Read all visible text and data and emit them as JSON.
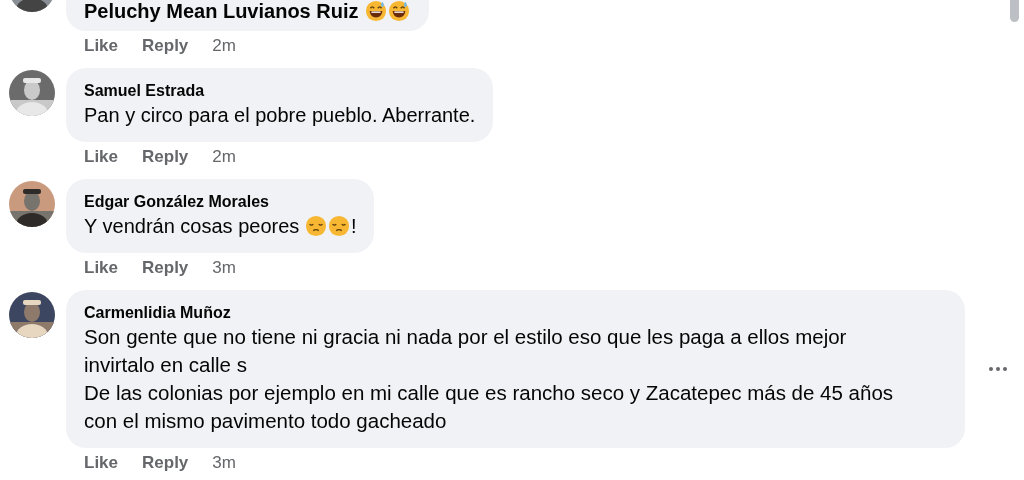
{
  "comments": [
    {
      "body": [
        {
          "kind": "mention",
          "text": "Peluchy Mean Luvianos Ruiz"
        },
        {
          "kind": "sweat-smile"
        },
        {
          "kind": "sweat-smile"
        }
      ],
      "actions": {
        "like": "Like",
        "reply": "Reply",
        "time": "2m"
      },
      "menu_button": false
    },
    {
      "author": "Samuel Estrada",
      "body": [
        {
          "kind": "text",
          "text": "Pan y circo para el pobre pueblo. Aberrante."
        }
      ],
      "actions": {
        "like": "Like",
        "reply": "Reply",
        "time": "2m"
      },
      "menu_button": false
    },
    {
      "author": "Edgar González Morales",
      "body": [
        {
          "kind": "text",
          "text": "Y vendrán cosas peores "
        },
        {
          "kind": "pensive"
        },
        {
          "kind": "pensive"
        },
        {
          "kind": "text",
          "text": "!"
        }
      ],
      "actions": {
        "like": "Like",
        "reply": "Reply",
        "time": "3m"
      },
      "menu_button": false
    },
    {
      "author": "Carmenlidia Muñoz",
      "paragraphs": [
        "Son gente que no tiene ni gracia ni nada por el estilo eso que les paga a ellos mejor invirtalo en calle s",
        "De las colonias por ejemplo en mi calle que es rancho seco y Zacatepec más de 45 años con el mismo pavimento todo gacheado"
      ],
      "actions": {
        "like": "Like",
        "reply": "Reply",
        "time": "3m"
      },
      "menu_button": true
    }
  ]
}
